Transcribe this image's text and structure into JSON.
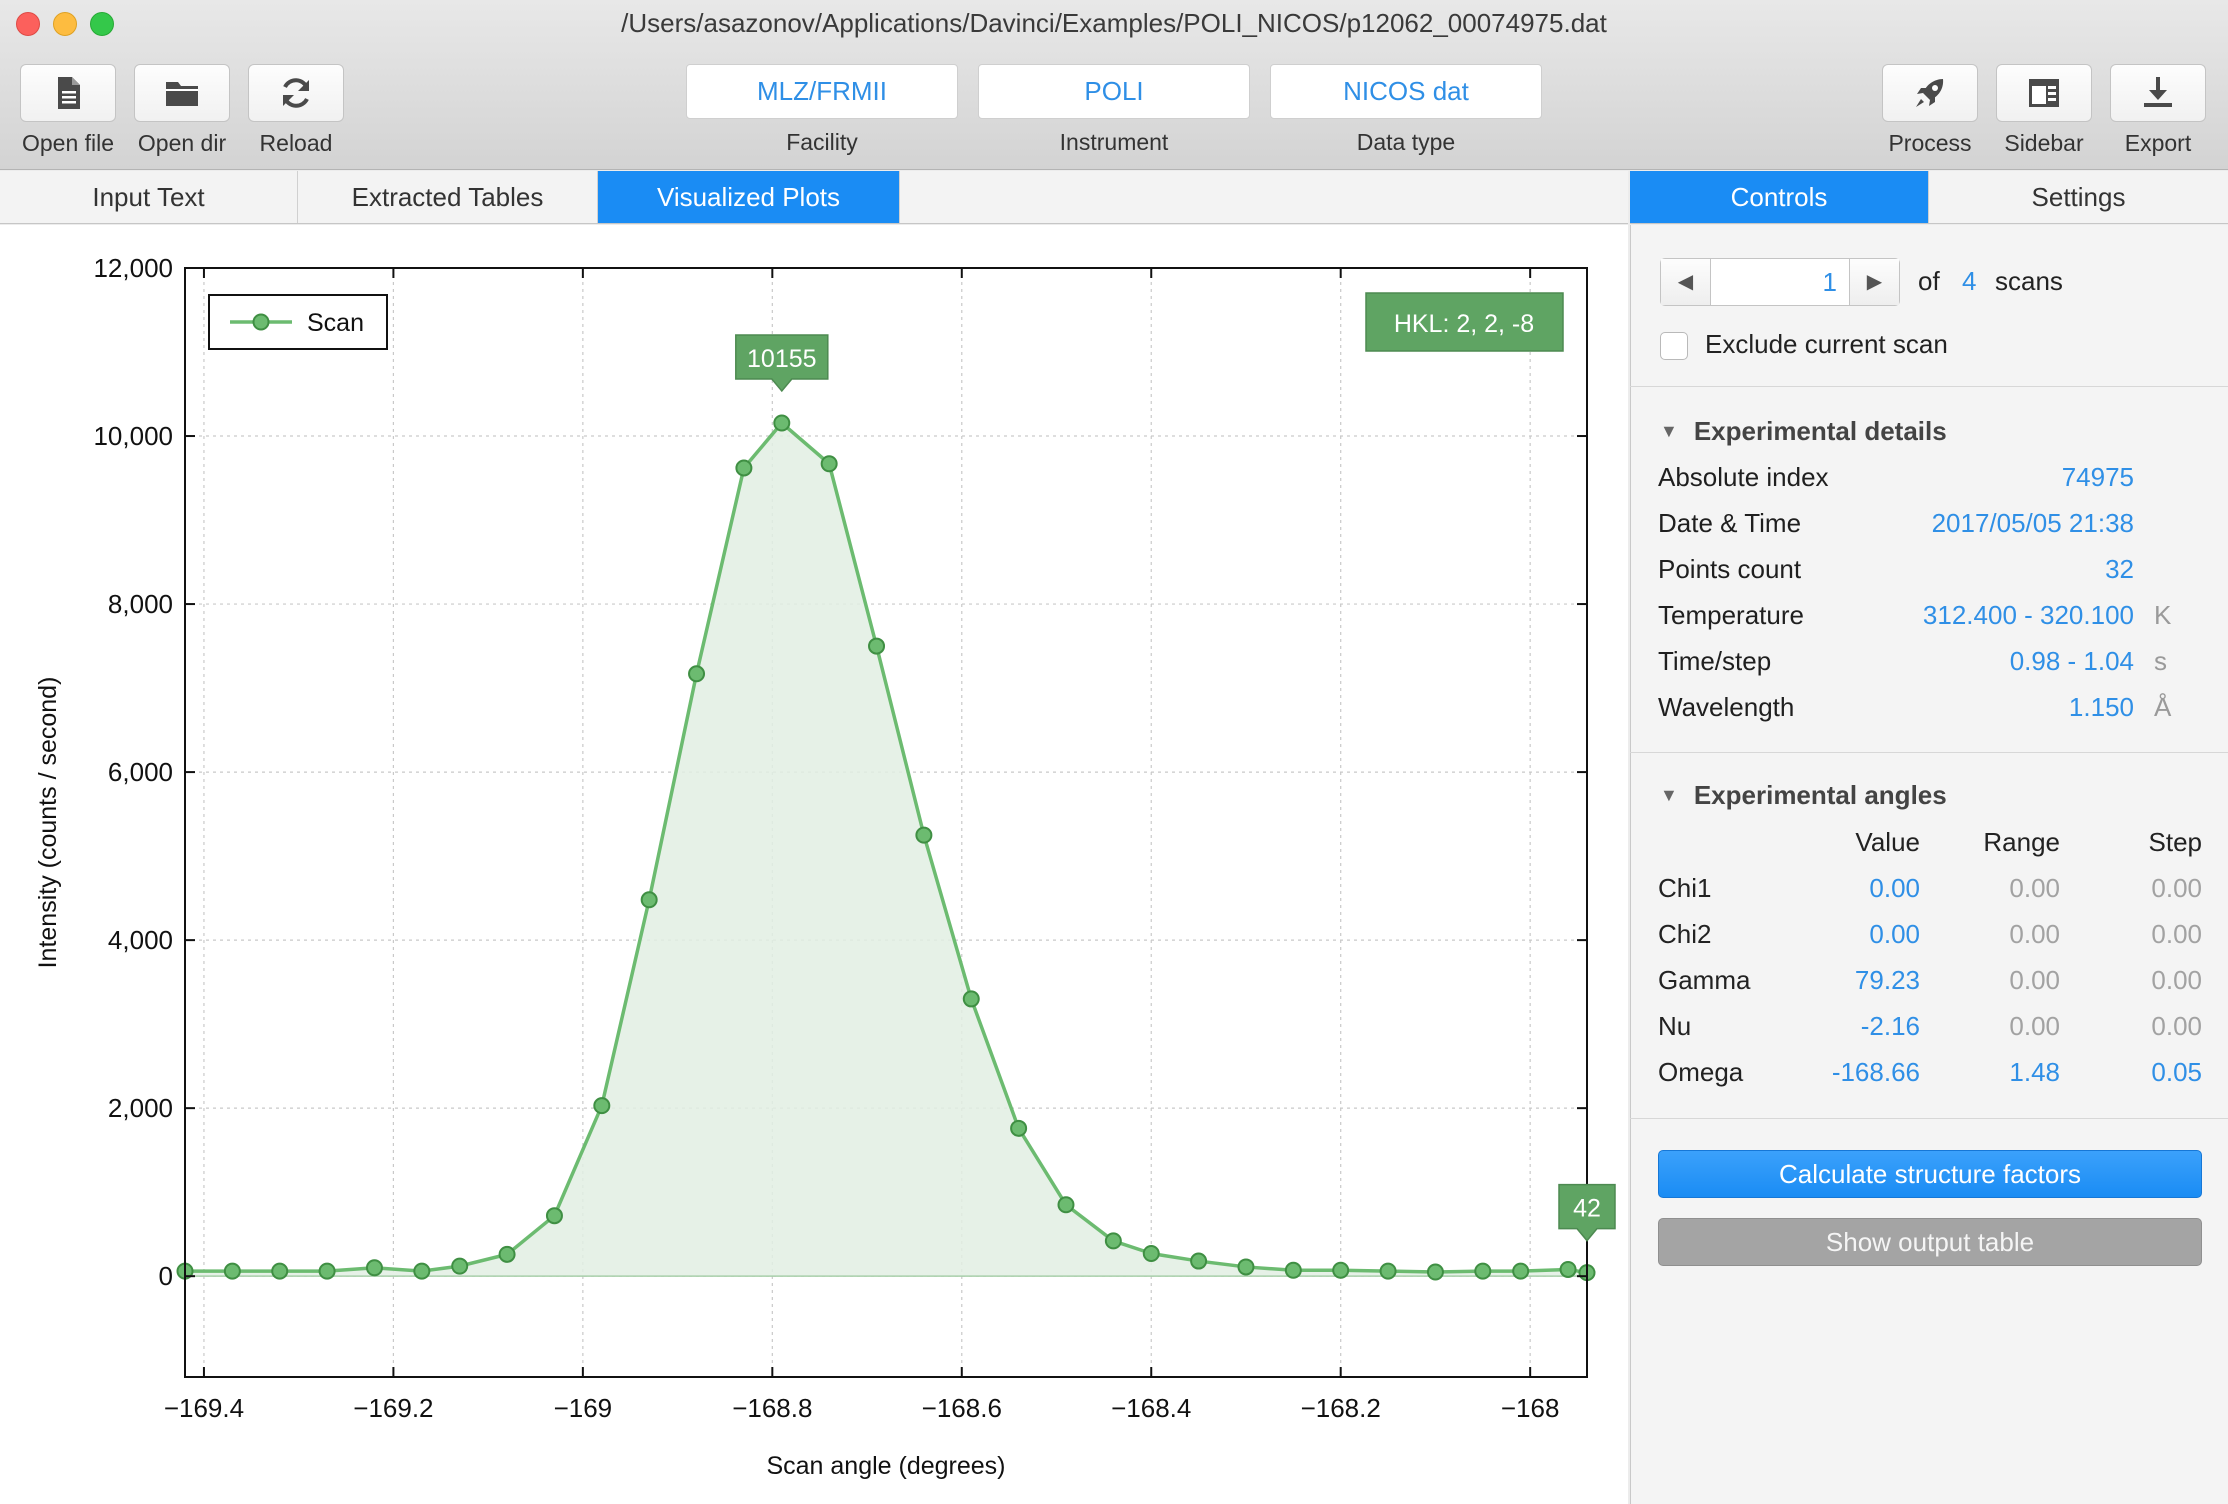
{
  "window": {
    "title": "/Users/asazonov/Applications/Davinci/Examples/POLI_NICOS/p12062_00074975.dat"
  },
  "toolbar": {
    "open_file": "Open file",
    "open_dir": "Open dir",
    "reload": "Reload",
    "facility_value": "MLZ/FRMII",
    "facility_label": "Facility",
    "instrument_value": "POLI",
    "instrument_label": "Instrument",
    "datatype_value": "NICOS dat",
    "datatype_label": "Data type",
    "process": "Process",
    "sidebar": "Sidebar",
    "export": "Export"
  },
  "tabs": [
    "Input Text",
    "Extracted Tables",
    "Visualized Plots"
  ],
  "sidebar_tabs": [
    "Controls",
    "Settings"
  ],
  "controls": {
    "scan_current": "1",
    "of_label": "of",
    "scan_total": "4",
    "scans_label": "scans",
    "exclude_label": "Exclude current scan",
    "exclude_checked": false
  },
  "details": {
    "title": "Experimental details",
    "rows": [
      {
        "key": "Absolute index",
        "value": "74975",
        "unit": ""
      },
      {
        "key": "Date & Time",
        "value": "2017/05/05 21:38",
        "unit": ""
      },
      {
        "key": "Points count",
        "value": "32",
        "unit": ""
      },
      {
        "key": "Temperature",
        "value": "312.400 - 320.100",
        "unit": "K"
      },
      {
        "key": "Time/step",
        "value": "0.98 - 1.04",
        "unit": "s"
      },
      {
        "key": "Wavelength",
        "value": "1.150",
        "unit": "Å"
      }
    ]
  },
  "angles": {
    "title": "Experimental angles",
    "headers": [
      "Value",
      "Range",
      "Step"
    ],
    "rows": [
      {
        "name": "Chi1",
        "value": "0.00",
        "range": "0.00",
        "step": "0.00"
      },
      {
        "name": "Chi2",
        "value": "0.00",
        "range": "0.00",
        "step": "0.00"
      },
      {
        "name": "Gamma",
        "value": "79.23",
        "range": "0.00",
        "step": "0.00"
      },
      {
        "name": "Nu",
        "value": "-2.16",
        "range": "0.00",
        "step": "0.00"
      },
      {
        "name": "Omega",
        "value": "-168.66",
        "range": "1.48",
        "step": "0.05"
      }
    ]
  },
  "buttons": {
    "calculate": "Calculate structure factors",
    "show_output": "Show output table"
  },
  "colors": {
    "accent": "#1a8cf4",
    "series": "#6cbb70",
    "fill": "#e2efe3",
    "label_bg": "#5fa463"
  },
  "chart_data": {
    "type": "line",
    "xlabel": "Scan angle (degrees)",
    "ylabel": "Intensity (counts / second)",
    "xlim": [
      -169.42,
      -167.94
    ],
    "ylim": [
      -1200,
      12000
    ],
    "xticks": [
      -169.4,
      -169.2,
      -169,
      -168.8,
      -168.6,
      -168.4,
      -168.2,
      -168
    ],
    "xtick_labels": [
      "−169.4",
      "−169.2",
      "−169",
      "−168.8",
      "−168.6",
      "−168.4",
      "−168.2",
      "−168"
    ],
    "yticks": [
      0,
      2000,
      4000,
      6000,
      8000,
      10000,
      12000
    ],
    "ytick_labels": [
      "0",
      "2,000",
      "4,000",
      "6,000",
      "8,000",
      "10,000",
      "12,000"
    ],
    "grid": true,
    "legend": "top-left",
    "series": [
      {
        "name": "Scan",
        "x": [
          -169.42,
          -169.37,
          -169.32,
          -169.27,
          -169.22,
          -169.17,
          -169.13,
          -169.08,
          -169.03,
          -168.98,
          -168.93,
          -168.88,
          -168.83,
          -168.79,
          -168.74,
          -168.69,
          -168.64,
          -168.59,
          -168.54,
          -168.49,
          -168.44,
          -168.4,
          -168.35,
          -168.3,
          -168.25,
          -168.2,
          -168.15,
          -168.1,
          -168.05,
          -168.01,
          -167.96,
          -167.94
        ],
        "y": [
          60,
          60,
          60,
          60,
          100,
          60,
          120,
          260,
          720,
          2030,
          4480,
          7170,
          9620,
          10155,
          9670,
          7500,
          5250,
          3300,
          1760,
          850,
          420,
          270,
          180,
          110,
          70,
          70,
          60,
          50,
          60,
          60,
          80,
          42
        ]
      }
    ],
    "annotations": [
      {
        "text": "10155",
        "x": -168.79,
        "y": 10155
      },
      {
        "text": "42",
        "x": -167.94,
        "y": 42
      }
    ],
    "badge": "HKL: 2, 2, -8"
  }
}
